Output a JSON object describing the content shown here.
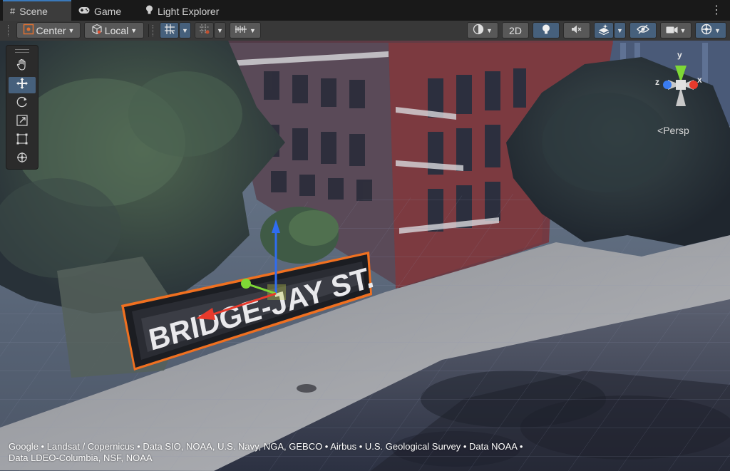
{
  "tabs": [
    {
      "label": "Scene",
      "icon": "grid-icon"
    },
    {
      "label": "Game",
      "icon": "gamepad-icon"
    },
    {
      "label": "Light Explorer",
      "icon": "lightbulb-icon"
    }
  ],
  "toolbar": {
    "pivot_mode": "Center",
    "pivot_rotation": "Local",
    "mode_2d": "2D"
  },
  "scene": {
    "sign_text": "BRIDGE-JAY ST.",
    "projection": "Persp",
    "axes": {
      "y": "y",
      "x": "x",
      "z": "z"
    }
  },
  "attribution": {
    "line1": "Google • Landsat / Copernicus • Data SIO, NOAA, U.S. Navy, NGA, GEBCO • Airbus • U.S. Geological Survey • Data NOAA •",
    "line2": "Data LDEO-Columbia, NSF, NOAA"
  },
  "colors": {
    "selection_outline": "#f07020",
    "axis_x": "#e83a2c",
    "axis_y": "#7ed836",
    "axis_z": "#3a7cf0",
    "active_button": "#46607c"
  }
}
